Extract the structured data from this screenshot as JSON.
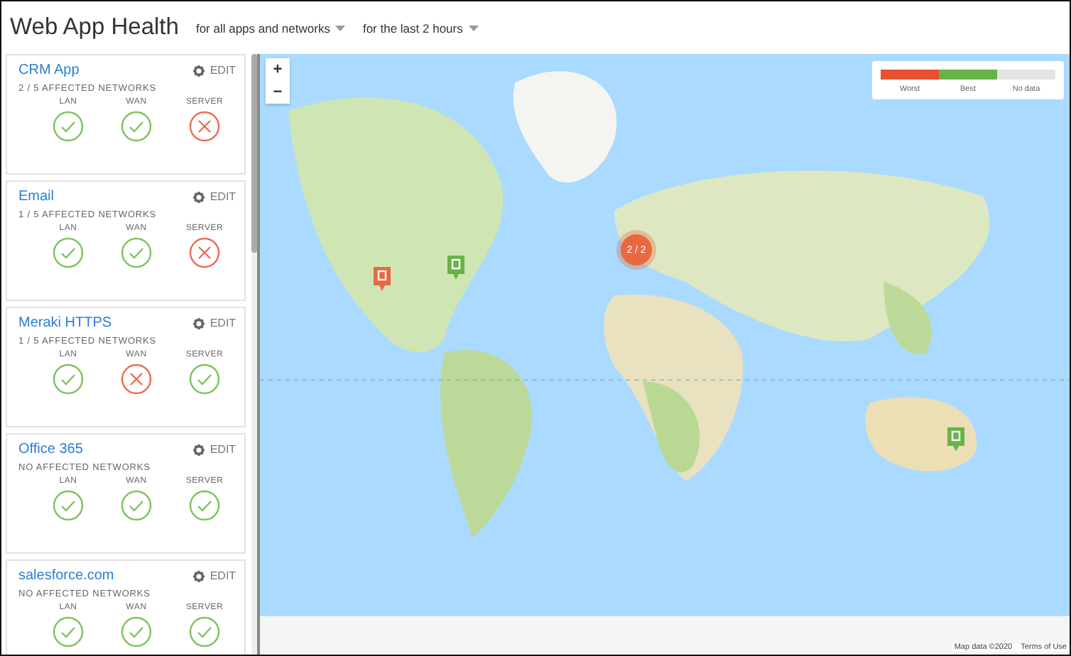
{
  "header": {
    "title": "Web App Health",
    "filters": [
      {
        "label": "for all apps and networks"
      },
      {
        "label": "for the last 2 hours"
      }
    ]
  },
  "apps": [
    {
      "name": "CRM App",
      "edit": "EDIT",
      "affected": "2 / 5 AFFECTED NETWORKS",
      "checks": [
        {
          "label": "LAN",
          "healthy": true
        },
        {
          "label": "WAN",
          "healthy": true
        },
        {
          "label": "SERVER",
          "healthy": false
        }
      ]
    },
    {
      "name": "Email",
      "edit": "EDIT",
      "affected": "1 / 5 AFFECTED NETWORKS",
      "checks": [
        {
          "label": "LAN",
          "healthy": true
        },
        {
          "label": "WAN",
          "healthy": true
        },
        {
          "label": "SERVER",
          "healthy": false
        }
      ]
    },
    {
      "name": "Meraki HTTPS",
      "edit": "EDIT",
      "affected": "1 / 5 AFFECTED NETWORKS",
      "checks": [
        {
          "label": "LAN",
          "healthy": true
        },
        {
          "label": "WAN",
          "healthy": false
        },
        {
          "label": "SERVER",
          "healthy": true
        }
      ]
    },
    {
      "name": "Office 365",
      "edit": "EDIT",
      "affected": "NO AFFECTED NETWORKS",
      "checks": [
        {
          "label": "LAN",
          "healthy": true
        },
        {
          "label": "WAN",
          "healthy": true
        },
        {
          "label": "SERVER",
          "healthy": true
        }
      ]
    },
    {
      "name": "salesforce.com",
      "edit": "EDIT",
      "affected": "NO AFFECTED NETWORKS",
      "checks": [
        {
          "label": "LAN",
          "healthy": true
        },
        {
          "label": "WAN",
          "healthy": true
        },
        {
          "label": "SERVER",
          "healthy": true
        }
      ]
    }
  ],
  "map": {
    "zoom_in": "+",
    "zoom_out": "−",
    "legend": [
      {
        "label": "Worst",
        "color": "#e8502f"
      },
      {
        "label": "Best",
        "color": "#67b348"
      },
      {
        "label": "No data",
        "color": "#e4e4e4"
      }
    ],
    "markers": [
      {
        "kind": "pin",
        "color": "#e8693f"
      },
      {
        "kind": "pin",
        "color": "#67b348"
      },
      {
        "kind": "cluster",
        "color": "#e8693f",
        "label": "2 / 2"
      },
      {
        "kind": "pin",
        "color": "#67b348"
      }
    ],
    "attribution": [
      "Map data ©2020",
      "Terms of Use"
    ]
  }
}
